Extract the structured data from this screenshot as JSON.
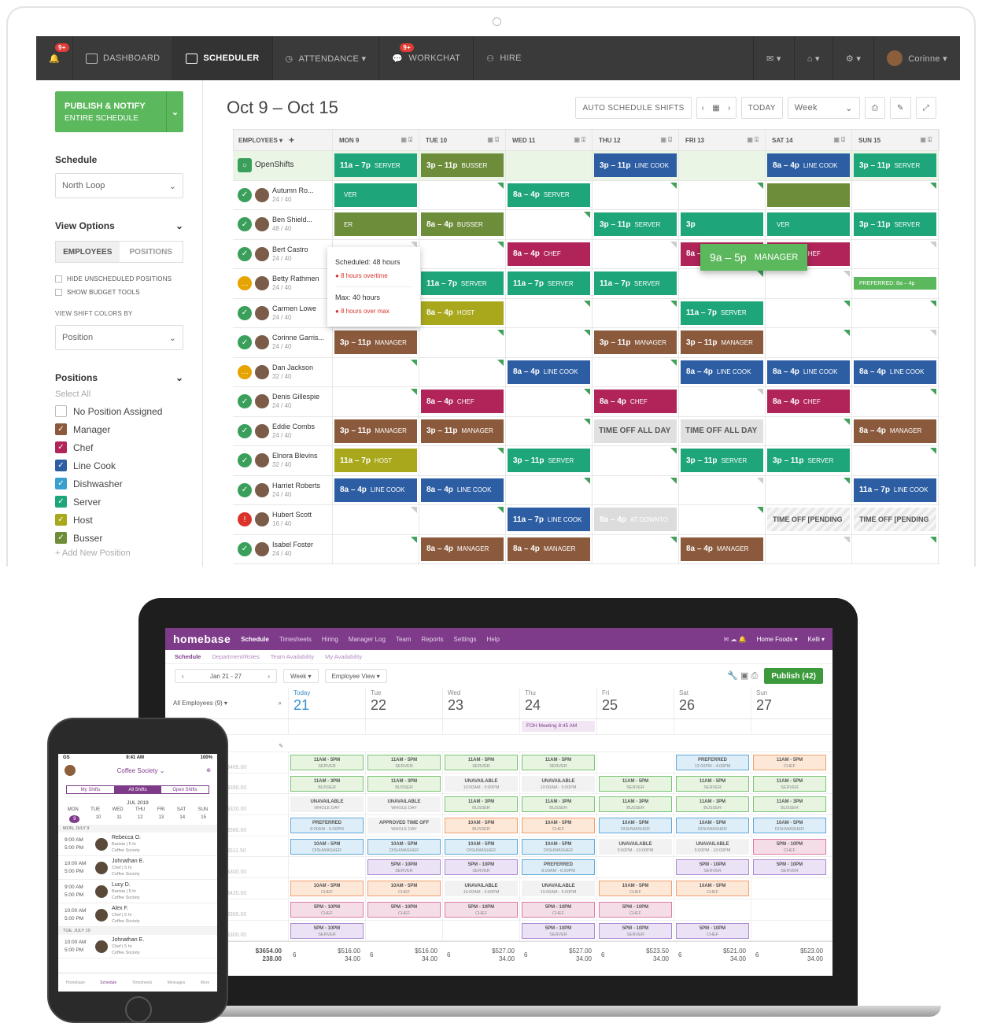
{
  "top": {
    "nav": {
      "alerts_badge": "9+",
      "items": [
        {
          "label": "DASHBOARD"
        },
        {
          "label": "SCHEDULER"
        },
        {
          "label": "ATTENDANCE ▾"
        },
        {
          "label": "WORKCHAT",
          "badge": "9+"
        },
        {
          "label": "HIRE"
        }
      ],
      "user": "Corinne ▾"
    },
    "sidebar": {
      "publish_title": "PUBLISH & NOTIFY",
      "publish_sub": "ENTIRE SCHEDULE",
      "schedule_label": "Schedule",
      "schedule_value": "North Loop",
      "view_options_label": "View Options",
      "toggle": [
        "EMPLOYEES",
        "POSITIONS"
      ],
      "hide_unscheduled": "HIDE UNSCHEDULED POSITIONS",
      "show_budget": "SHOW BUDGET TOOLS",
      "view_colors_label": "VIEW SHIFT COLORS BY",
      "view_colors_value": "Position",
      "positions_label": "Positions",
      "select_all": "Select All",
      "positions": [
        {
          "name": "No Position Assigned",
          "color": "#ffffff"
        },
        {
          "name": "Manager",
          "color": "#8b5a3c"
        },
        {
          "name": "Chef",
          "color": "#b0245a"
        },
        {
          "name": "Line Cook",
          "color": "#2d5ea3"
        },
        {
          "name": "Dishwasher",
          "color": "#3aa0d0"
        },
        {
          "name": "Server",
          "color": "#1fa57a"
        },
        {
          "name": "Host",
          "color": "#a9a81c"
        },
        {
          "name": "Busser",
          "color": "#6e8d3a"
        }
      ],
      "add_position": "+ Add New Position"
    },
    "header": {
      "range": "Oct 9 – Oct 15",
      "auto": "AUTO SCHEDULE SHIFTS",
      "today": "TODAY",
      "view": "Week"
    },
    "grid": {
      "col0": "EMPLOYEES ▾",
      "days": [
        "MON 9",
        "TUE 10",
        "WED 11",
        "THU 12",
        "FRI 13",
        "SAT 14",
        "SUN 15"
      ],
      "rows": [
        {
          "name": "OpenShifts",
          "hours": "",
          "status": "open",
          "cells": [
            [
              "11a – 7p",
              "SERVER",
              "server"
            ],
            [
              "3p – 11p",
              "BUSSER",
              "busser"
            ],
            null,
            [
              "3p – 11p",
              "LINE COOK",
              "linecook"
            ],
            null,
            [
              "8a – 4p",
              "LINE COOK",
              "linecook"
            ],
            [
              "3p – 11p",
              "SERVER",
              "server"
            ]
          ]
        },
        {
          "name": "Autumn Ro...",
          "hours": "24 / 40",
          "status": "ok",
          "cells": [
            [
              "",
              "VER",
              "server"
            ],
            null,
            [
              "8a – 4p",
              "SERVER",
              "server"
            ],
            null,
            null,
            [
              "",
              "",
              "busser"
            ],
            null
          ]
        },
        {
          "name": "Ben Shield...",
          "hours": "48 / 40",
          "status": "ok",
          "cells": [
            [
              "",
              "ER",
              "busser"
            ],
            [
              "8a – 4p",
              "BUSSER",
              "busser"
            ],
            null,
            [
              "3p – 11p",
              "SERVER",
              "server"
            ],
            [
              "3p",
              "",
              "server"
            ],
            [
              "",
              "VER",
              "server"
            ],
            [
              "3p – 11p",
              "SERVER",
              "server"
            ]
          ]
        },
        {
          "name": "Bert Castro",
          "hours": "24 / 40",
          "status": "ok",
          "cells": [
            null,
            null,
            [
              "8a – 4p",
              "CHEF",
              "chef"
            ],
            null,
            [
              "8a – 4p",
              "CHEF",
              "chef"
            ],
            [
              "8a – 4p",
              "CHEF",
              "chef"
            ],
            null
          ]
        },
        {
          "name": "Betty Rathmen",
          "hours": "24 / 40",
          "status": "warn",
          "cells": [
            null,
            [
              "11a – 7p",
              "SERVER",
              "server"
            ],
            [
              "11a – 7p",
              "SERVER",
              "server"
            ],
            [
              "11a – 7p",
              "SERVER",
              "server"
            ],
            null,
            null,
            [
              "PREFERRED: 8a – 4p",
              "",
              "pref"
            ]
          ]
        },
        {
          "name": "Carmen Lowe",
          "hours": "24 / 40",
          "status": "ok",
          "cells": [
            [
              "8a – 4p",
              "HOST",
              "host"
            ],
            [
              "8a – 4p",
              "HOST",
              "host"
            ],
            null,
            null,
            [
              "11a – 7p",
              "SERVER",
              "server"
            ],
            null,
            null
          ]
        },
        {
          "name": "Corinne Garris...",
          "hours": "24 / 40",
          "status": "ok",
          "cells": [
            [
              "3p – 11p",
              "MANAGER",
              "manager"
            ],
            null,
            null,
            [
              "3p – 11p",
              "MANAGER",
              "manager"
            ],
            [
              "3p – 11p",
              "MANAGER",
              "manager"
            ],
            null,
            null
          ]
        },
        {
          "name": "Dan Jackson",
          "hours": "32 / 40",
          "status": "warn",
          "cells": [
            null,
            null,
            [
              "8a – 4p",
              "LINE COOK",
              "linecook"
            ],
            null,
            [
              "8a – 4p",
              "LINE COOK",
              "linecook"
            ],
            [
              "8a – 4p",
              "LINE COOK",
              "linecook"
            ],
            [
              "8a – 4p",
              "LINE COOK",
              "linecook"
            ]
          ]
        },
        {
          "name": "Denis Gillespie",
          "hours": "24 / 40",
          "status": "ok",
          "cells": [
            null,
            [
              "8a – 4p",
              "CHEF",
              "chef"
            ],
            null,
            [
              "8a – 4p",
              "CHEF",
              "chefs"
            ],
            null,
            [
              "8a – 4p",
              "CHEF",
              "chefs"
            ],
            null
          ]
        },
        {
          "name": "Eddie Combs",
          "hours": "24 / 40",
          "status": "ok",
          "cells": [
            [
              "3p – 11p",
              "MANAGER",
              "manager"
            ],
            [
              "3p – 11p",
              "MANAGER",
              "manager"
            ],
            null,
            [
              "TIME OFF ALL DAY",
              "",
              "off"
            ],
            [
              "TIME OFF ALL DAY",
              "",
              "off"
            ],
            null,
            [
              "8a – 4p",
              "MANAGER",
              "manager"
            ]
          ]
        },
        {
          "name": "Elnora Blevins",
          "hours": "32 / 40",
          "status": "ok",
          "cells": [
            [
              "11a – 7p",
              "HOST",
              "host"
            ],
            null,
            [
              "3p – 11p",
              "SERVER",
              "server"
            ],
            null,
            [
              "3p – 11p",
              "SERVER",
              "server"
            ],
            [
              "3p – 11p",
              "SERVER",
              "server"
            ],
            null
          ]
        },
        {
          "name": "Harriet Roberts",
          "hours": "24 / 40",
          "status": "ok",
          "cells": [
            [
              "8a – 4p",
              "LINE COOK",
              "linecooks"
            ],
            [
              "8a – 4p",
              "LINE COOK",
              "linecooks"
            ],
            null,
            null,
            null,
            null,
            [
              "11a – 7p",
              "LINE COOK",
              "linecook"
            ]
          ]
        },
        {
          "name": "Hubert Scott",
          "hours": "16 / 40",
          "status": "err",
          "cells": [
            null,
            null,
            [
              "11a – 7p",
              "LINE COOK",
              "linecook"
            ],
            [
              "8a – 4p",
              "AT DOWNTO",
              "ghost"
            ],
            null,
            [
              "TIME OFF [PENDING",
              "",
              "offp"
            ],
            [
              "TIME OFF [PENDING",
              "",
              "offp"
            ]
          ]
        },
        {
          "name": "Isabel Foster",
          "hours": "24 / 40",
          "status": "ok",
          "cells": [
            null,
            [
              "8a – 4p",
              "MANAGER",
              "manager"
            ],
            [
              "8a – 4p",
              "MANAGER",
              "manager"
            ],
            null,
            [
              "8a – 4p",
              "MANAGER",
              "manager"
            ],
            null,
            null
          ]
        }
      ]
    },
    "tooltip": {
      "scheduled": "Scheduled: 48 hours",
      "overtime": "8 hours overtime",
      "max": "Max: 40 hours",
      "over": "8 hours over max"
    },
    "drag": {
      "time": "9a – 5p",
      "role": "MANAGER"
    }
  },
  "bottom": {
    "nav": {
      "logo": "homebase",
      "items": [
        "Schedule",
        "Timesheets",
        "Hiring",
        "Manager Log",
        "Team",
        "Reports",
        "Settings",
        "Help"
      ],
      "location": "Home Foods ▾",
      "user": "Kelli ▾"
    },
    "subnav": [
      "Schedule",
      "Department/Roles",
      "Team Availability",
      "My Availability"
    ],
    "toolbar": {
      "range": "Jan 21 - 27",
      "view": "Week ▾",
      "mode": "Employee View ▾",
      "publish": "Publish (42)"
    },
    "filter": "All Employees (9) ▾",
    "days": [
      [
        "Today",
        "21"
      ],
      [
        "Tue",
        "22"
      ],
      [
        "Wed",
        "23"
      ],
      [
        "Thu",
        "24"
      ],
      [
        "Fri",
        "25"
      ],
      [
        "Sat",
        "26"
      ],
      [
        "Sun",
        "27"
      ]
    ],
    "event": "FOH Meeting 8:45 AM",
    "wages": [
      "$465.00",
      "$390.00",
      "$320.00",
      "$560.00",
      "$511.50",
      "$300.00",
      "$420.00",
      "$900.00",
      "$300.00"
    ],
    "rows": [
      [
        [
          "11AM - 5PM",
          "SERVER",
          "g"
        ],
        [
          "11AM - 5PM",
          "SERVER",
          "g"
        ],
        [
          "11AM - 5PM",
          "SERVER",
          "g"
        ],
        [
          "11AM - 5PM",
          "SERVER",
          "g"
        ],
        null,
        [
          "PREFERRED",
          "12:00PM - 4:00PM",
          "b"
        ],
        [
          "11AM - 5PM",
          "CHEF",
          "o"
        ]
      ],
      [
        [
          "11AM - 3PM",
          "BUSSER",
          "g"
        ],
        [
          "11AM - 3PM",
          "BUSSER",
          "g"
        ],
        [
          "UNAVAILABLE",
          "10:00AM - 5:00PM",
          "gr"
        ],
        [
          "UNAVAILABLE",
          "10:00AM - 5:00PM",
          "gr"
        ],
        [
          "11AM - 5PM",
          "SERVER",
          "g"
        ],
        [
          "11AM - 5PM",
          "SERVER",
          "g"
        ],
        [
          "11AM - 5PM",
          "SERVER",
          "g"
        ]
      ],
      [
        [
          "UNAVAILABLE",
          "WHOLE DAY",
          "gr"
        ],
        [
          "UNAVAILABLE",
          "WHOLE DAY",
          "gr"
        ],
        [
          "11AM - 3PM",
          "BUSSER",
          "g"
        ],
        [
          "11AM - 3PM",
          "BUSSER",
          "g"
        ],
        [
          "11AM - 3PM",
          "BUSSER",
          "g"
        ],
        [
          "11AM - 3PM",
          "BUSSER",
          "g"
        ],
        [
          "11AM - 3PM",
          "BUSSER",
          "g"
        ]
      ],
      [
        [
          "PREFERRED",
          "8:00AM - 6:00PM",
          "b"
        ],
        [
          "APPROVED TIME OFF",
          "WHOLE DAY",
          "gr"
        ],
        [
          "10AM - 5PM",
          "BUSSER",
          "o"
        ],
        [
          "10AM - 5PM",
          "CHEF",
          "o"
        ],
        [
          "10AM - 5PM",
          "DISHWASHER",
          "b"
        ],
        [
          "10AM - 5PM",
          "DISHWASHER",
          "b"
        ],
        [
          "10AM - 5PM",
          "DISHWASHER",
          "b"
        ]
      ],
      [
        [
          "10AM - 5PM",
          "DISHWASHER",
          "b"
        ],
        [
          "10AM - 5PM",
          "DISHWASHER",
          "b"
        ],
        [
          "10AM - 5PM",
          "DISHWASHER",
          "b"
        ],
        [
          "10AM - 5PM",
          "DISHWASHER",
          "b"
        ],
        [
          "UNAVAILABLE",
          "5:00PM - 10:00PM",
          "gr"
        ],
        [
          "UNAVAILABLE",
          "5:00PM - 10:00PM",
          "gr"
        ],
        [
          "5PM - 10PM",
          "CHEF",
          "p"
        ]
      ],
      [
        null,
        [
          "5PM - 10PM",
          "SERVER",
          "v"
        ],
        [
          "5PM - 10PM",
          "SERVER",
          "v"
        ],
        [
          "PREFERRED",
          "8:00AM - 6:00PM",
          "b"
        ],
        null,
        [
          "5PM - 10PM",
          "SERVER",
          "v"
        ],
        [
          "5PM - 10PM",
          "SERVER",
          "v"
        ]
      ],
      [
        [
          "10AM - 5PM",
          "CHEF",
          "o"
        ],
        [
          "10AM - 5PM",
          "CHEF",
          "o"
        ],
        [
          "UNAVAILABLE",
          "10:00AM - 5:00PM",
          "gr"
        ],
        [
          "UNAVAILABLE",
          "10:00AM - 5:00PM",
          "gr"
        ],
        [
          "10AM - 5PM",
          "CHEF",
          "o"
        ],
        [
          "10AM - 5PM",
          "CHEF",
          "o"
        ],
        null
      ],
      [
        [
          "5PM - 10PM",
          "CHEF",
          "p"
        ],
        [
          "5PM - 10PM",
          "CHEF",
          "p"
        ],
        [
          "5PM - 10PM",
          "CHEF",
          "p"
        ],
        [
          "5PM - 10PM",
          "CHEF",
          "p"
        ],
        [
          "5PM - 10PM",
          "CHEF",
          "p"
        ],
        null,
        null
      ],
      [
        [
          "5PM - 10PM",
          "SERVER",
          "v"
        ],
        null,
        null,
        [
          "5PM - 10PM",
          "SERVER",
          "v"
        ],
        [
          "5PM - 10PM",
          "SERVER",
          "v"
        ],
        [
          "5PM - 10PM",
          "CHEF",
          "v"
        ],
        null
      ]
    ],
    "footer": {
      "total": "$3654.00",
      "total2": "238.00",
      "days": [
        [
          "6",
          "$516.00",
          "34.00"
        ],
        [
          "6",
          "$516.00",
          "34.00"
        ],
        [
          "6",
          "$527.00",
          "34.00"
        ],
        [
          "6",
          "$527.00",
          "34.00"
        ],
        [
          "6",
          "$523.50",
          "34.00"
        ],
        [
          "6",
          "$521.00",
          "34.00"
        ],
        [
          "6",
          "$523.00",
          "34.00"
        ]
      ]
    }
  },
  "phone": {
    "time": "9:41 AM",
    "signal": "GS",
    "battery": "100%",
    "title": "Coffee Society ⌄",
    "tabs": [
      "My Shifts",
      "All Shifts",
      "Open Shifts"
    ],
    "month": "JUL 2019",
    "weekdays": [
      "MON",
      "TUE",
      "WED",
      "THU",
      "FRI",
      "SAT",
      "SUN"
    ],
    "dates": [
      "9",
      "10",
      "11",
      "12",
      "13",
      "14",
      "15"
    ],
    "day1": "MON, JULY 9",
    "entries": [
      [
        "9:00 AM",
        "5:00 PM",
        "Rebecca O.",
        "Barista | 5 hr",
        "Coffee Society"
      ],
      [
        "10:00 AM",
        "5:00 PM",
        "Johnathan E.",
        "Chef | 5 hr",
        "Coffee Society"
      ],
      [
        "9:00 AM",
        "5:00 PM",
        "Lucy D.",
        "Barista | 5 hr",
        "Coffee Society"
      ],
      [
        "10:00 AM",
        "5:00 PM",
        "Alex F.",
        "Chef | 5 hr",
        "Coffee Society"
      ]
    ],
    "day2": "TUE, JULY 10",
    "entry5": [
      "10:00 AM",
      "5:00 PM",
      "Johnathan E.",
      "Chef | 5 hr",
      "Coffee Society"
    ],
    "tabbar": [
      "Homebase",
      "Schedule",
      "Timesheets",
      "Messages",
      "More"
    ]
  },
  "colors": {
    "server": "#1fa57a",
    "busser": "#6e8d3a",
    "linecook": "#2d5ea3",
    "chef": "#b0245a",
    "host": "#a9a81c",
    "manager": "#8b5a3c",
    "ghost": "#dcdcdc",
    "pref": "#5cb85c"
  }
}
